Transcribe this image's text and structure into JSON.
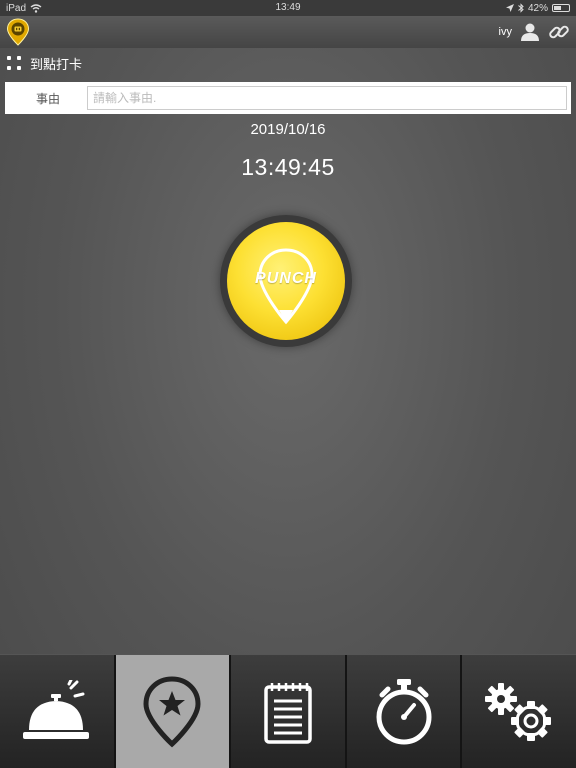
{
  "status_bar": {
    "device": "iPad",
    "time": "13:49",
    "battery": "42%"
  },
  "nav": {
    "username": "ivy"
  },
  "sub_header": {
    "title": "到點打卡"
  },
  "reason": {
    "label": "事由",
    "placeholder": "請輸入事由.",
    "value": ""
  },
  "clock": {
    "date": "2019/10/16",
    "time": "13:49:45"
  },
  "punch": {
    "label": "PUNCH",
    "color": "#fde033"
  },
  "tabs": [
    {
      "icon": "service-bell-icon",
      "active": false
    },
    {
      "icon": "map-pin-star-icon",
      "active": true
    },
    {
      "icon": "notepad-icon",
      "active": false
    },
    {
      "icon": "stopwatch-icon",
      "active": false
    },
    {
      "icon": "gears-icon",
      "active": false
    }
  ],
  "colors": {
    "background": "#555555",
    "tab_active": "#a9a9a9",
    "tab_bar": "#1c1c1c"
  }
}
